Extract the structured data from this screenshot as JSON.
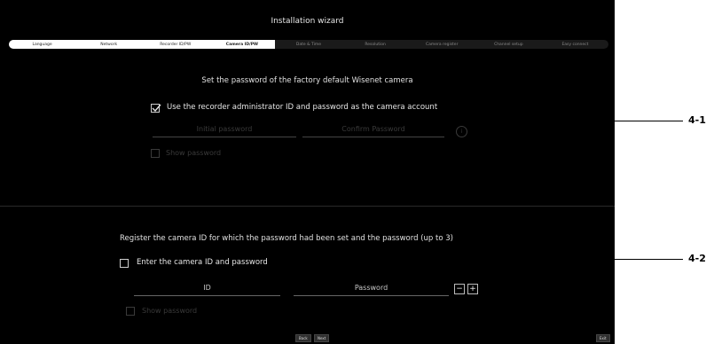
{
  "wizard": {
    "title": "Installation wizard",
    "steps": [
      "Language",
      "Network",
      "Recorder ID/PW",
      "Camera ID/PW",
      "Date & Time",
      "Resolution",
      "Camera register",
      "Channel setup",
      "Easy connect"
    ]
  },
  "section1": {
    "heading": "Set the password of the factory default Wisenet camera",
    "use_admin_label": "Use the recorder administrator ID and password as the camera account",
    "use_admin_checked": true,
    "initial_password_placeholder": "Initial password",
    "confirm_password_placeholder": "Confirm Password",
    "show_password_label": "Show password"
  },
  "section2": {
    "heading": "Register the camera ID for which the password had been set and the password (up to 3)",
    "enter_label": "Enter the camera ID and password",
    "enter_checked": false,
    "id_label": "ID",
    "password_label": "Password",
    "minus": "−",
    "plus": "+",
    "show_password_label": "Show password"
  },
  "footer": {
    "back": "Back",
    "next": "Next",
    "exit": "Exit"
  },
  "callouts": {
    "c1": "4-1",
    "c2": "4-2"
  }
}
